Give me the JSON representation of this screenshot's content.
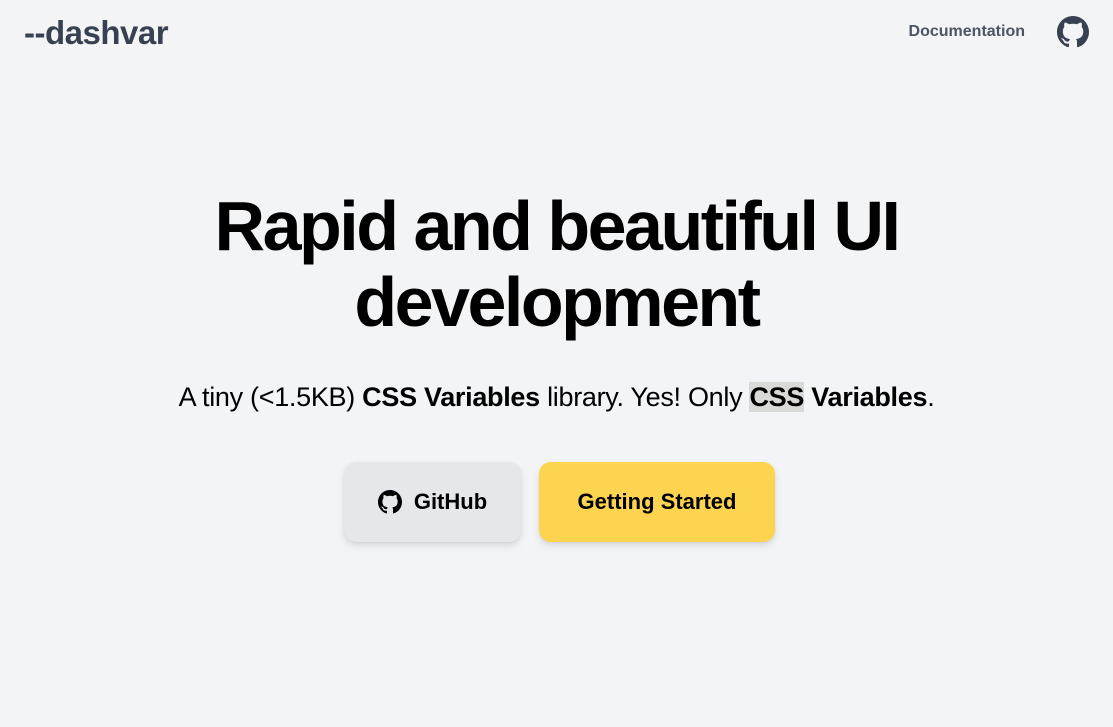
{
  "header": {
    "brand": "--dashvar",
    "nav_documentation": "Documentation",
    "github_icon": "github-icon"
  },
  "hero": {
    "headline_line1": "Rapid and beautiful UI",
    "headline_line2": "development",
    "subline_part1": "A tiny (<1.5KB) ",
    "subline_bold1": "CSS Variables",
    "subline_part2": " library. Yes! Only ",
    "subline_highlight": "CSS",
    "subline_bold2": " Variables",
    "subline_end": "."
  },
  "actions": {
    "github_label": "GitHub",
    "github_icon": "github-icon",
    "start_label": "Getting Started"
  },
  "colors": {
    "background": "#f3f4f6",
    "brand_text": "#374151",
    "primary_button": "#fdd44f",
    "secondary_button": "#e5e7eb"
  }
}
